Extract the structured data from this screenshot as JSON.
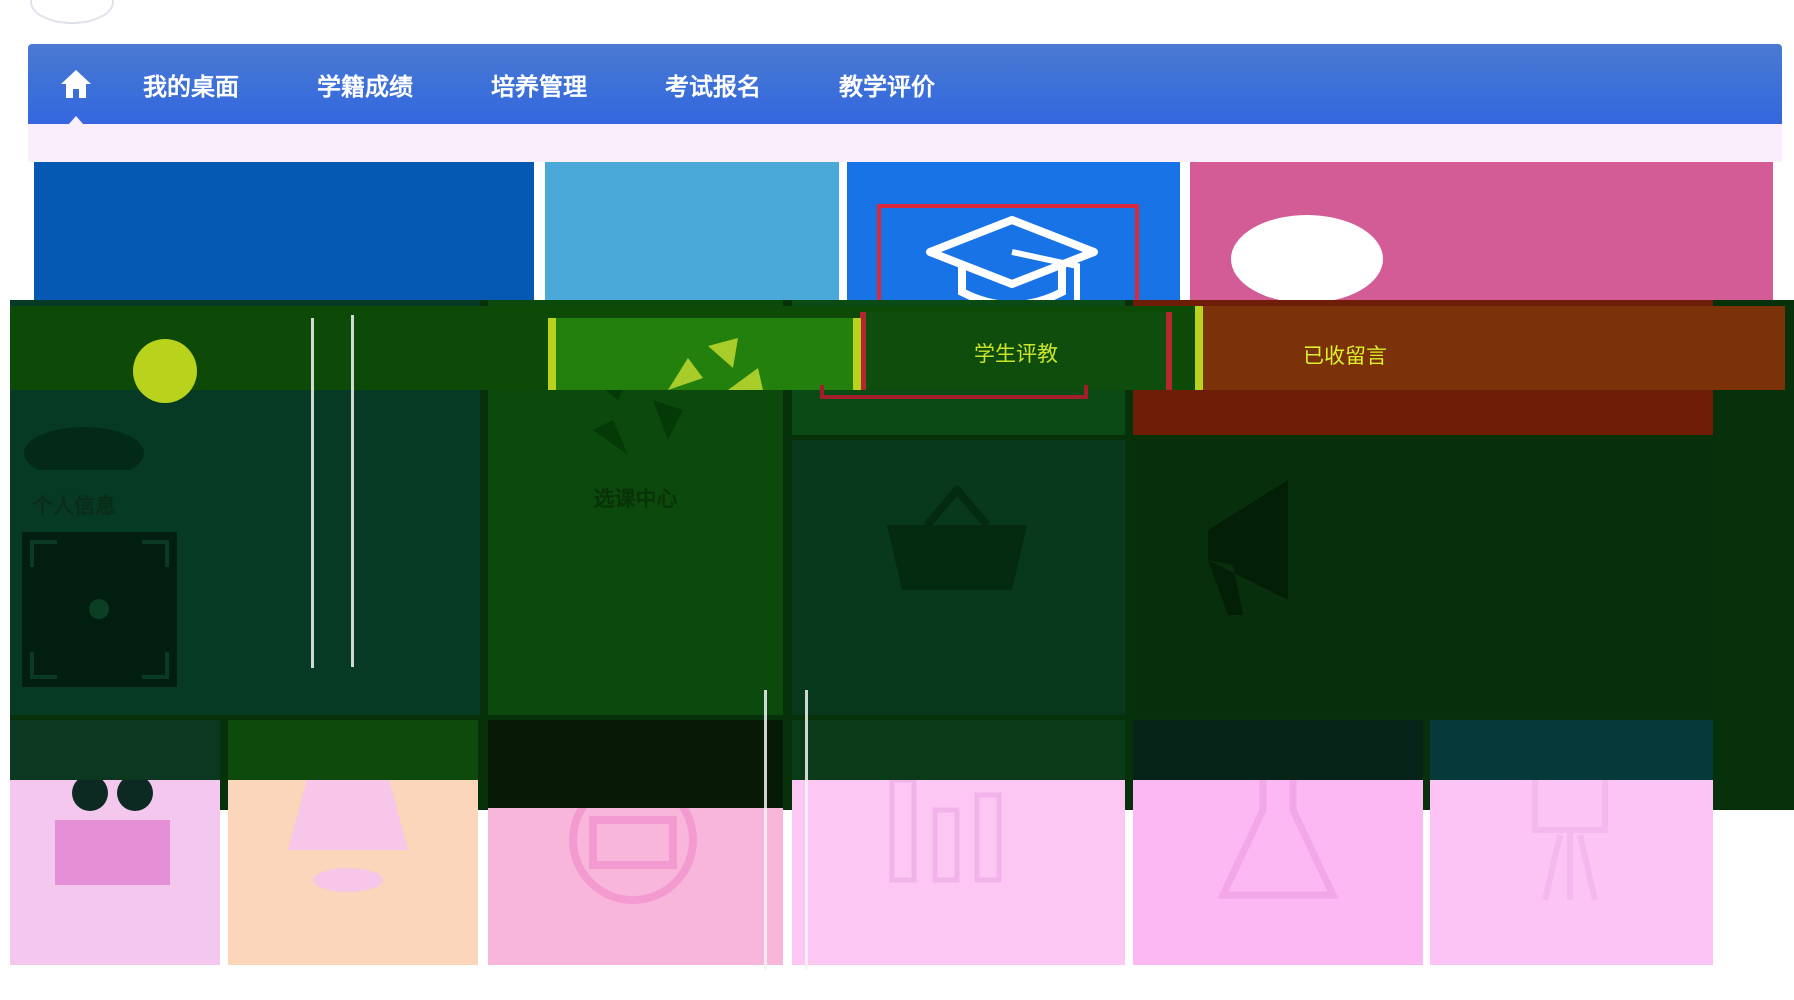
{
  "navbar": {
    "home_icon": "home-icon",
    "items": [
      {
        "label": "我的桌面"
      },
      {
        "label": "学籍成绩"
      },
      {
        "label": "培养管理"
      },
      {
        "label": "考试报名"
      },
      {
        "label": "教学评价"
      }
    ]
  },
  "tiles": {
    "student_eval": {
      "label": "学生评教",
      "icon": "graduation-cap-icon"
    },
    "received_messages": {
      "label": "已收留言",
      "icon": "speech-bubble-icon"
    },
    "profile": {
      "label": "个人信息",
      "icon": "user-icon"
    },
    "course_center": {
      "label": "选课中心",
      "icon": "recycle-icon"
    },
    "basket": {
      "label": "",
      "icon": "basket-icon"
    },
    "notice": {
      "label": "",
      "icon": "megaphone-icon"
    },
    "bottom": [
      {
        "label": "",
        "icon": "people-icon"
      },
      {
        "label": "",
        "icon": "lamp-icon"
      },
      {
        "label": "",
        "icon": "radio-icon"
      },
      {
        "label": "",
        "icon": "bar-chart-icon"
      },
      {
        "label": "",
        "icon": "flask-icon"
      },
      {
        "label": "",
        "icon": "easel-icon"
      }
    ]
  },
  "colors": {
    "nav_blue": "#3b6fd9",
    "tile_dark_blue": "#0559b3",
    "tile_sky": "#4aa9d8",
    "tile_student_blue": "#1773e6",
    "tile_pink": "#d45c96",
    "highlight_red": "#d8283a",
    "accent_yellow": "#b9d21c"
  }
}
